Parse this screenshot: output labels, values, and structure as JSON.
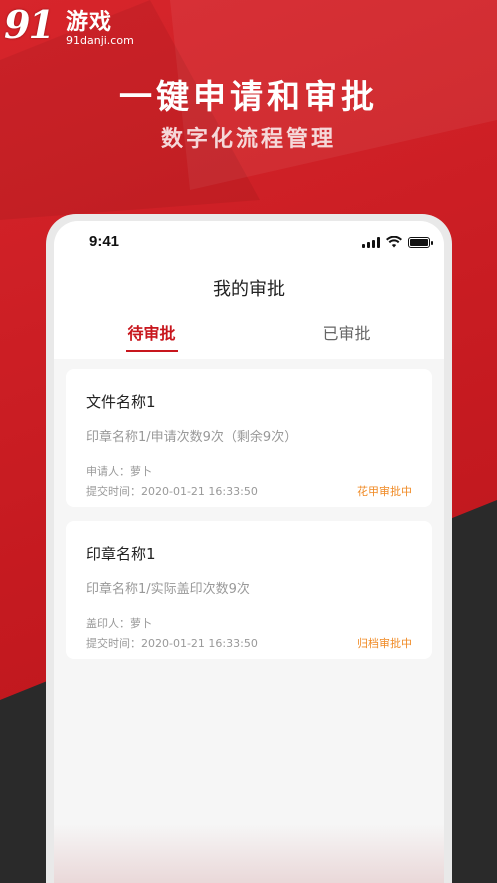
{
  "logo": {
    "number": "91",
    "name": "游戏",
    "url": "91danji.com"
  },
  "headline": "一键申请和审批",
  "subline": "数字化流程管理",
  "phone": {
    "status_time": "9:41",
    "page_title": "我的审批",
    "tabs": [
      {
        "label": "待审批",
        "active": true
      },
      {
        "label": "已审批",
        "active": false
      }
    ],
    "cards": [
      {
        "title": "文件名称1",
        "desc": "印章名称1/申请次数9次（剩余9次）",
        "person": "申请人：萝卜",
        "time": "提交时间：2020-01-21  16:33:50",
        "status": "花甲审批中"
      },
      {
        "title": "印章名称1",
        "desc": "印章名称1/实际盖印次数9次",
        "person": "盖印人：萝卜",
        "time": "提交时间：2020-01-21  16:33:50",
        "status": "归档审批中"
      }
    ]
  },
  "colors": {
    "brand": "#c8161d",
    "status": "#f08a24"
  }
}
